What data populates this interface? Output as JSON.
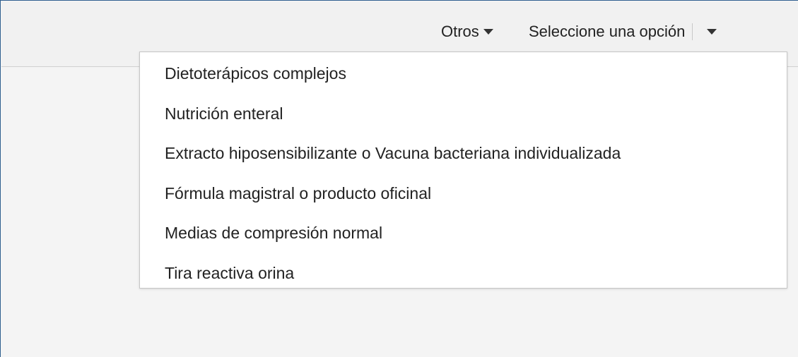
{
  "toolbar": {
    "otros_label": "Otros",
    "select_value": "Seleccione una opción"
  },
  "dropdown": {
    "options": [
      "Dietoterápicos complejos",
      "Nutrición enteral",
      "Extracto hiposensibilizante o Vacuna bacteriana individualizada",
      "Fórmula magistral o producto oficinal",
      "Medias de compresión normal",
      "Tira reactiva orina"
    ]
  },
  "icons": {
    "otros_caret": "caret-down-icon",
    "select_caret": "caret-down-icon"
  }
}
